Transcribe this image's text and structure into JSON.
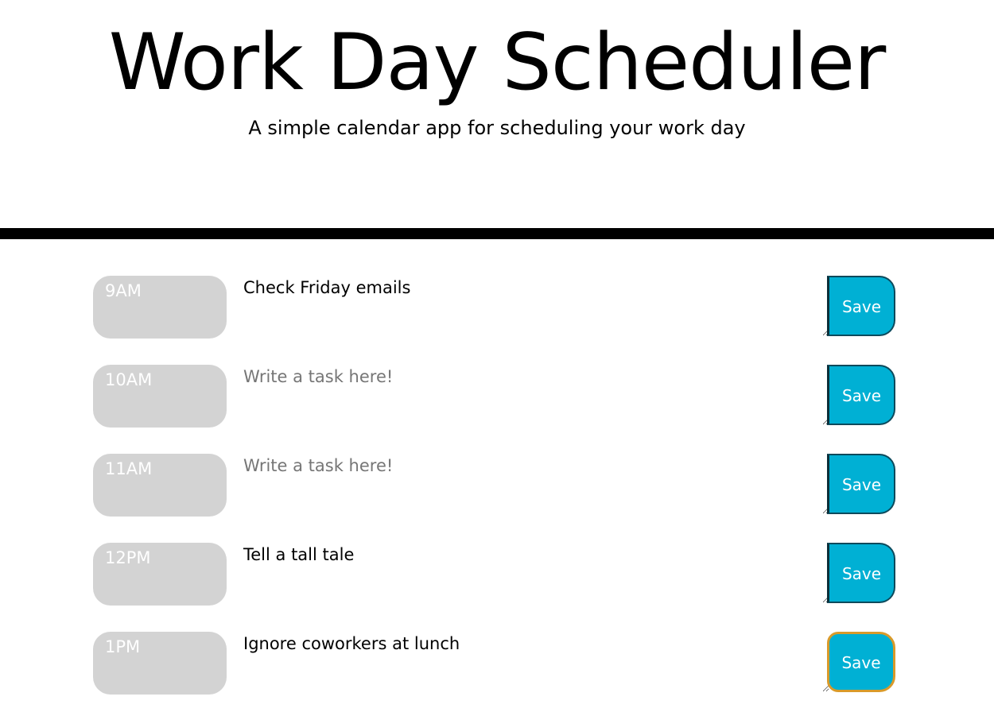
{
  "header": {
    "title": "Work Day Scheduler",
    "subtitle": "A simple calendar app for scheduling your work day"
  },
  "colors": {
    "hour_block": "#d3d3d3",
    "save_button": "#00b0d4",
    "divider": "#000000",
    "focus_ring": "#d99a2a"
  },
  "rows": [
    {
      "hour": "9AM",
      "task": "Check Friday emails",
      "placeholder": "Write a task here!",
      "save_label": "Save"
    },
    {
      "hour": "10AM",
      "task": "",
      "placeholder": "Write a task here!",
      "save_label": "Save"
    },
    {
      "hour": "11AM",
      "task": "",
      "placeholder": "Write a task here!",
      "save_label": "Save"
    },
    {
      "hour": "12PM",
      "task": "Tell a tall tale",
      "placeholder": "Write a task here!",
      "save_label": "Save"
    },
    {
      "hour": "1PM",
      "task": "Ignore coworkers at lunch",
      "placeholder": "Write a task here!",
      "save_label": "Save"
    }
  ]
}
